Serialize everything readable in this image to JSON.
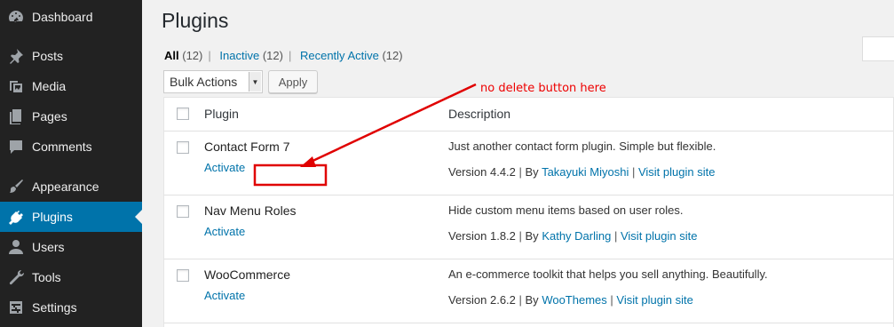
{
  "sidebar": {
    "items": [
      {
        "label": "Dashboard",
        "icon": "dashboard-icon",
        "active": false
      },
      {
        "label": "Posts",
        "icon": "pin-icon",
        "active": false
      },
      {
        "label": "Media",
        "icon": "media-icon",
        "active": false
      },
      {
        "label": "Pages",
        "icon": "pages-icon",
        "active": false
      },
      {
        "label": "Comments",
        "icon": "comment-icon",
        "active": false
      },
      {
        "label": "Appearance",
        "icon": "brush-icon",
        "active": false
      },
      {
        "label": "Plugins",
        "icon": "plug-icon",
        "active": true
      },
      {
        "label": "Users",
        "icon": "user-icon",
        "active": false
      },
      {
        "label": "Tools",
        "icon": "wrench-icon",
        "active": false
      },
      {
        "label": "Settings",
        "icon": "settings-icon",
        "active": false
      }
    ]
  },
  "page": {
    "title": "Plugins",
    "filters": [
      {
        "label": "All",
        "count": "(12)",
        "current": true
      },
      {
        "label": "Inactive",
        "count": "(12)",
        "current": false
      },
      {
        "label": "Recently Active",
        "count": "(12)",
        "current": false
      }
    ],
    "bulk_actions": "Bulk Actions",
    "apply": "Apply"
  },
  "table": {
    "col_plugin": "Plugin",
    "col_description": "Description",
    "rows": [
      {
        "name": "Contact Form 7",
        "action": "Activate",
        "description": "Just another contact form plugin. Simple but flexible.",
        "version": "Version 4.4.2",
        "by": "By",
        "author": "Takayuki Miyoshi",
        "site": "Visit plugin site"
      },
      {
        "name": "Nav Menu Roles",
        "action": "Activate",
        "description": "Hide custom menu items based on user roles.",
        "version": "Version 1.8.2",
        "by": "By",
        "author": "Kathy Darling",
        "site": "Visit plugin site"
      },
      {
        "name": "WooCommerce",
        "action": "Activate",
        "description": "An e-commerce toolkit that helps you sell anything. Beautifully.",
        "version": "Version 2.6.2",
        "by": "By",
        "author": "WooThemes",
        "site": "Visit plugin site"
      }
    ]
  },
  "annotation": {
    "note": "no delete button here",
    "color": "#e00000"
  },
  "colors": {
    "sidebar_bg": "#222222",
    "active_bg": "#0073aa",
    "link": "#0073aa"
  }
}
